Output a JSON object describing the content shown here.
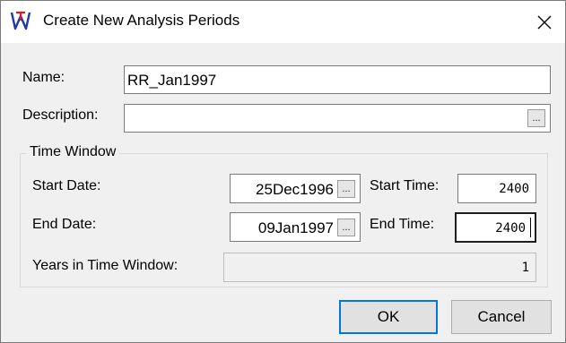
{
  "window": {
    "title": "Create New Analysis Periods",
    "app_icon": "wv-app-icon",
    "close_glyph": "✕"
  },
  "form": {
    "name_label": "Name:",
    "name_value": "RR_Jan1997",
    "description_label": "Description:",
    "description_value": "",
    "browse_glyph": "..."
  },
  "time_window": {
    "group_label": "Time Window",
    "start_date_label": "Start Date:",
    "start_date_value": "25Dec1996",
    "start_time_label": "Start Time:",
    "start_time_value": "2400",
    "end_date_label": "End Date:",
    "end_date_value": "09Jan1997",
    "end_time_label": "End Time:",
    "end_time_value": "2400",
    "years_label": "Years in Time Window:",
    "years_value": "1"
  },
  "buttons": {
    "ok_label": "OK",
    "cancel_label": "Cancel"
  },
  "colors": {
    "focus_border": "#0078d7",
    "dialog_bg": "#f0f0f0"
  }
}
